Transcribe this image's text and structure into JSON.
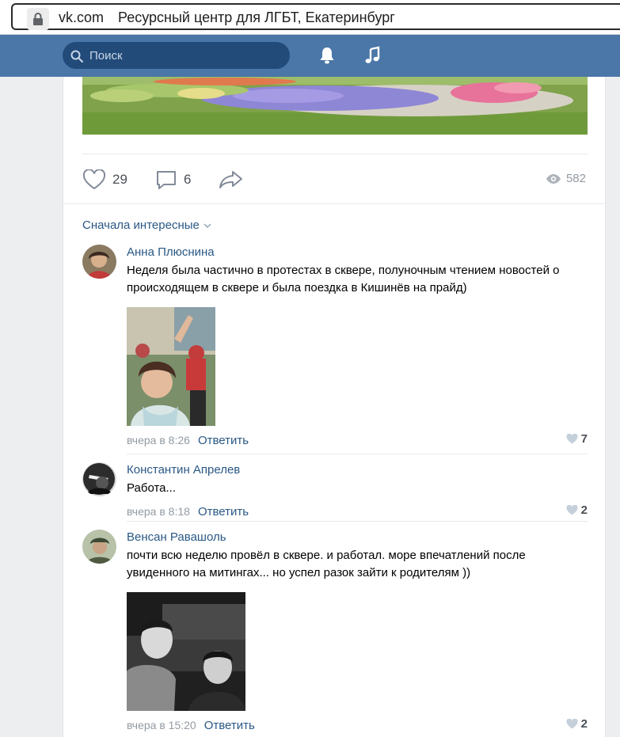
{
  "browser": {
    "domain": "vk.com",
    "title": "Ресурсный центр для ЛГБТ, Екатеринбург"
  },
  "header": {
    "search_placeholder": "Поиск",
    "icons": [
      "bell-icon",
      "music-icon"
    ]
  },
  "post": {
    "likes": "29",
    "comments": "6",
    "views": "582"
  },
  "sort_label": "Сначала интересные",
  "comments": [
    {
      "author": "Анна Плюснина",
      "text": "Неделя была частично в протестах в сквере, полуночным чтением новостей о происходящем в сквере и была поездка в Кишинёв на прайд)",
      "date": "вчера в 8:26",
      "reply": "Ответить",
      "likes": "7"
    },
    {
      "author": "Константин Апрелев",
      "text": "Работа...",
      "date": "вчера в 8:18",
      "reply": "Ответить",
      "likes": "2"
    },
    {
      "author": "Венсан Равашоль",
      "text": "почти всю неделю провёл в сквере. и работал. море впечатлений после увиденного на митингах... но успел разок зайти к родителям ))",
      "date": "вчера в 15:20",
      "reply": "Ответить",
      "likes": "2"
    }
  ],
  "colors": {
    "vk_blue": "#4a76a8",
    "link": "#2a5885",
    "muted": "#939ba3"
  }
}
